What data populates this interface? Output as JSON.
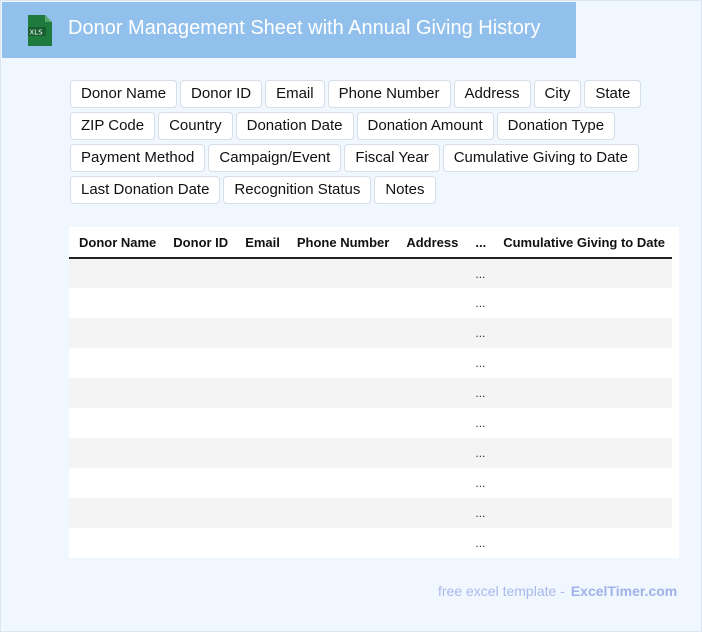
{
  "header": {
    "title": "Donor Management Sheet with Annual Giving History",
    "logo_text": "XLS",
    "logo_color": "#1f7a3e",
    "bg_color": "#92c0ec"
  },
  "tags": [
    "Donor Name",
    "Donor ID",
    "Email",
    "Phone Number",
    "Address",
    "City",
    "State",
    "ZIP Code",
    "Country",
    "Donation Date",
    "Donation Amount",
    "Donation Type",
    "Payment Method",
    "Campaign/Event",
    "Fiscal Year",
    "Cumulative Giving to Date",
    "Last Donation Date",
    "Recognition Status",
    "Notes"
  ],
  "table": {
    "columns": [
      "Donor Name",
      "Donor ID",
      "Email",
      "Phone Number",
      "Address",
      "...",
      "Cumulative Giving to Date"
    ],
    "rows": [
      [
        "",
        "",
        "",
        "",
        "",
        "...",
        ""
      ],
      [
        "",
        "",
        "",
        "",
        "",
        "...",
        ""
      ],
      [
        "",
        "",
        "",
        "",
        "",
        "...",
        ""
      ],
      [
        "",
        "",
        "",
        "",
        "",
        "...",
        ""
      ],
      [
        "",
        "",
        "",
        "",
        "",
        "...",
        ""
      ],
      [
        "",
        "",
        "",
        "",
        "",
        "...",
        ""
      ],
      [
        "",
        "",
        "",
        "",
        "",
        "...",
        ""
      ],
      [
        "",
        "",
        "",
        "",
        "",
        "...",
        ""
      ],
      [
        "",
        "",
        "",
        "",
        "",
        "...",
        ""
      ],
      [
        "",
        "",
        "",
        "",
        "",
        "...",
        ""
      ]
    ]
  },
  "footer": {
    "text": "free excel template -",
    "brand": "ExcelTimer.com"
  }
}
